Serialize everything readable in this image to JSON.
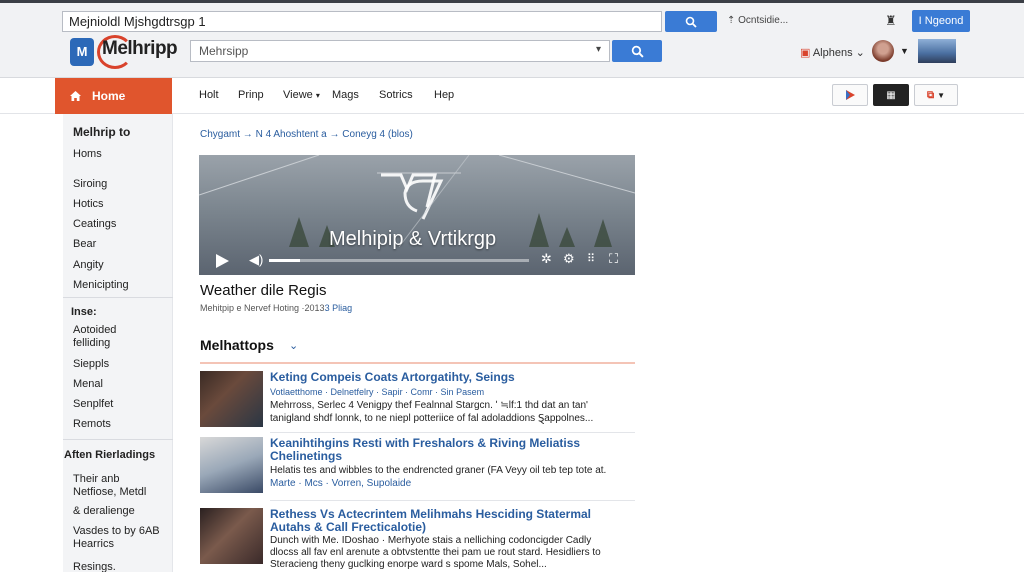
{
  "browser": {
    "url": "Mejnioldl Mjshgdtrsgp 1",
    "options_label": "⇡ Ocntsidie...",
    "signin_label": "I Ngeond"
  },
  "header": {
    "logo_text": "Melhripp",
    "search_placeholder": "Mehrsipp",
    "alerts_label": "Alphens",
    "alerts_caret": "⌄"
  },
  "nav": {
    "home_label": "Home",
    "items": [
      "Holt",
      "Prinp",
      "Viewe",
      "Mags",
      "Sotrics",
      "Hep"
    ]
  },
  "sidebar": {
    "section1_title": "Melhrip to",
    "section1_items": [
      "Homs",
      "Siroing",
      "Hotics",
      "Ceatings",
      "Bear",
      "Angity",
      "Menicipting"
    ],
    "section2_title": "Inse:",
    "section2_items": [
      "Aotoided felliding",
      "Sieppls",
      "Menal",
      "Senplfet",
      "Remots"
    ],
    "section3_title": "Aften Rierladings",
    "section3_items": [
      "Their anb Netfiose, Metdl",
      "& deralienge",
      "Vasdes to by 6AB Hearrics",
      "Resings."
    ]
  },
  "main": {
    "breadcrumb": "Chygamt → N 4 Ahoshtent a → Coneyg 4 (blos)",
    "video_title": "Melhipip & Vrtikrgp",
    "video_progress": 0.12,
    "article_title": "Weather dile Regis",
    "article_meta": "Mehitpip e Nervef Hoting ·2013",
    "article_meta_link": "3 Pliag",
    "section_heading": "Melhattops",
    "stories": [
      {
        "title": "Keting Compeis Coats Artorgatihty, Seings",
        "line1": "Votlaetthome · Delnetfelry · Sapir · Comr · Sin Pasem",
        "line2": "Mehrross, Serlec 4 Venigpy thef Fealnnal Stargcn. ʹ ≒lf:1 thd dat an tan'",
        "line3": "tanigland shdf lonnk, to ne niepl potteriice of fal adoladdions Ȿappolnes..."
      },
      {
        "title": "Keanihtihgins Resti with Freshalors & Riving Meliatiss Chelinetings",
        "line1": "Helatis tes and wibbles to the endrencted graner (FA Veyy oil teb tep tote at.",
        "line2": "Marte · Mcs · Vorren, Supolaide"
      },
      {
        "title": "Rethess Vs Actecrintem Melihmahs Hesciding Statermal Autahs & Call Frecticalotie)",
        "line1": "Dunch with Me. IDoshao · Merhyote stais a nelliching codoncigder Cadly",
        "line2": "dlocss all fav enl arenute a obtvstentte thei pam ue rout stard. Hesidliers to",
        "line3": "Steracieng theny guclking enorpe ward s spome Mals, Sohel..."
      }
    ]
  },
  "colors": {
    "accent": "#e0552d",
    "link": "#2a5d9f",
    "button": "#3a7bd5"
  }
}
